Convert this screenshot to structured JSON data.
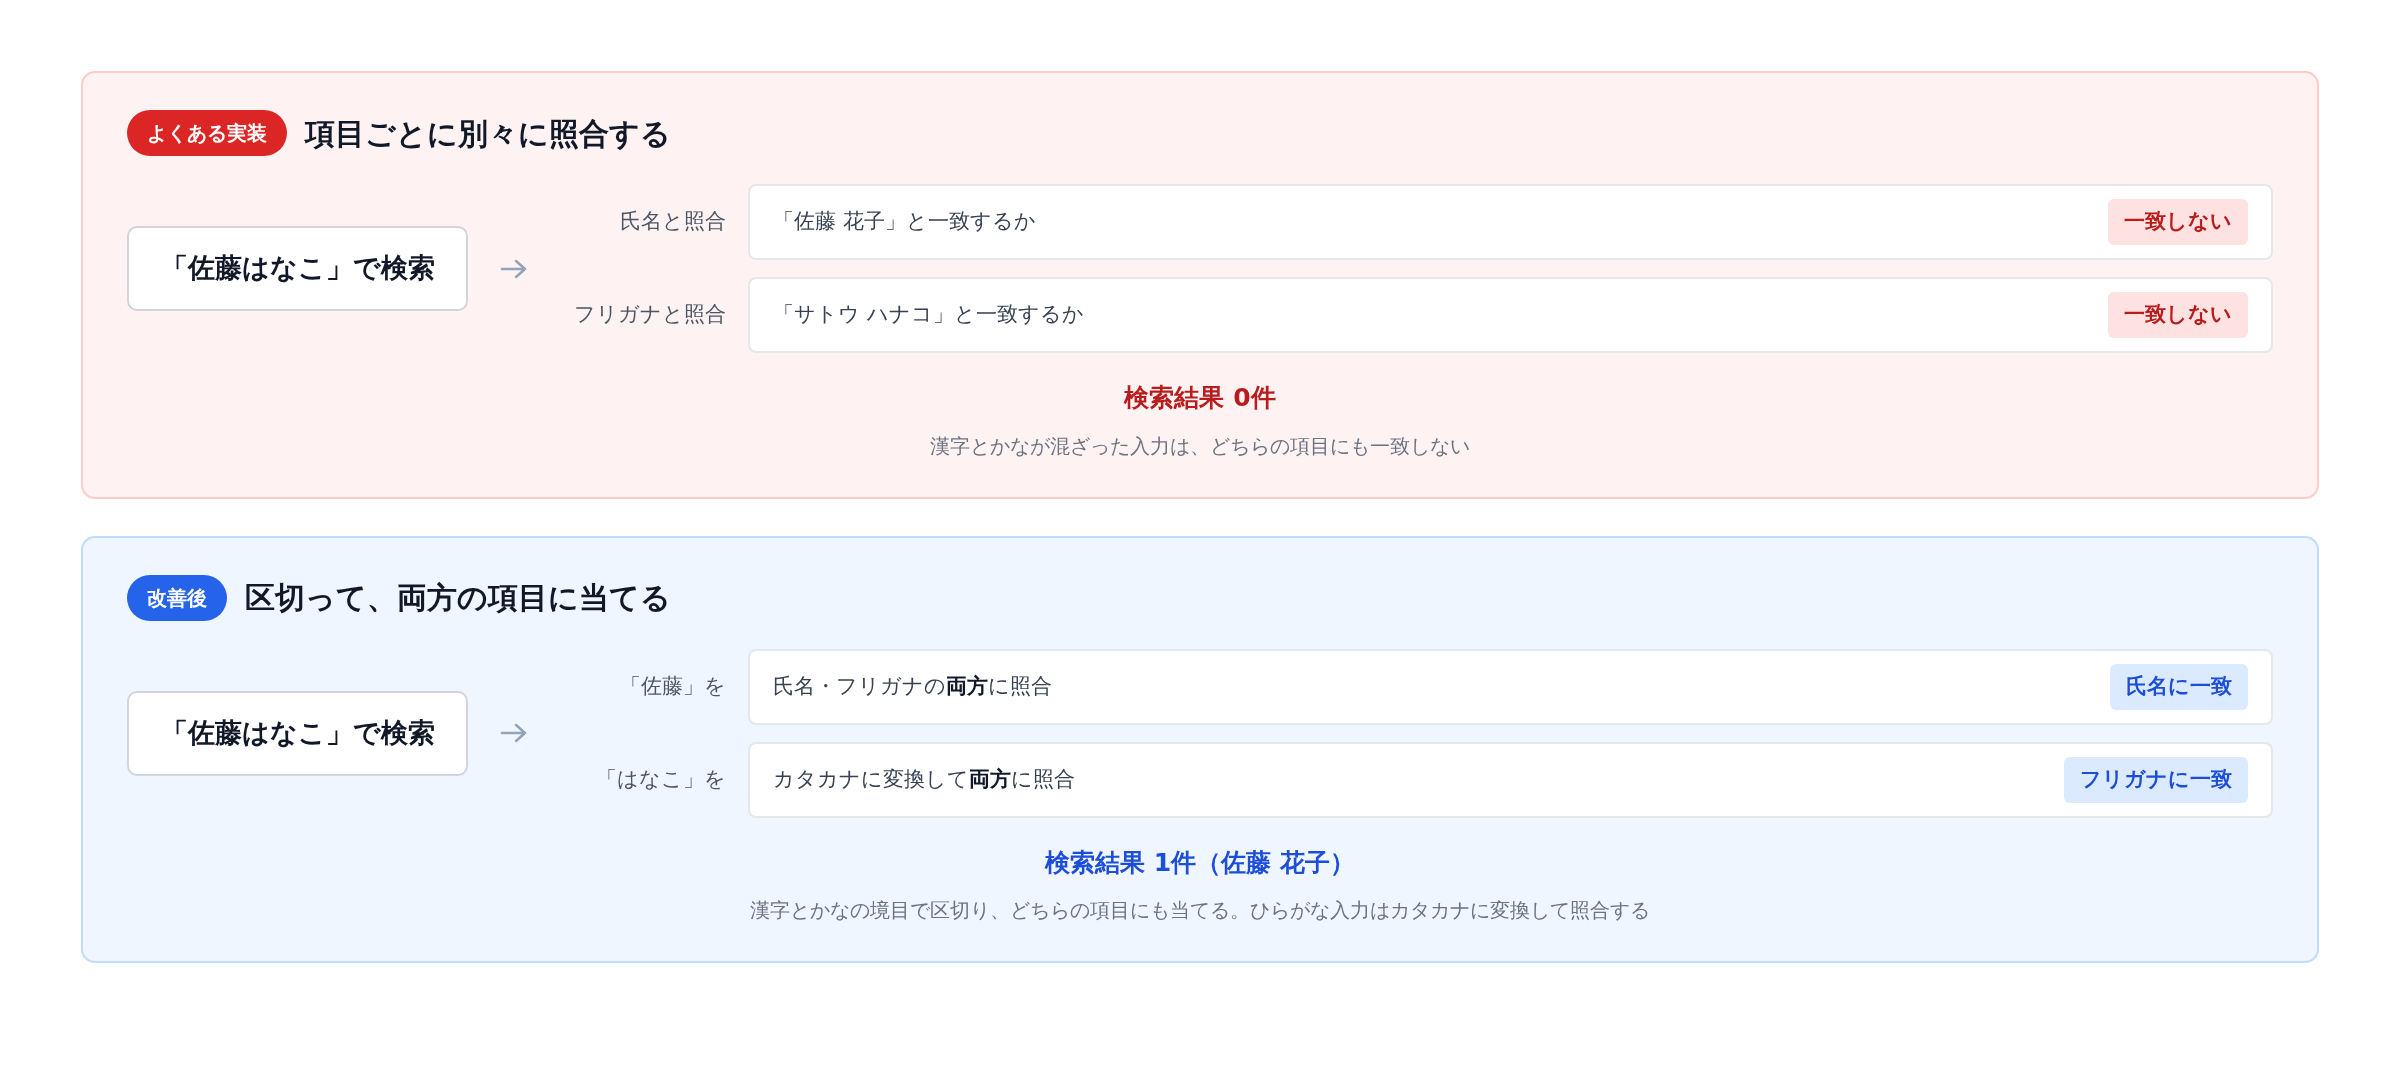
{
  "panels": [
    {
      "kind": "bad",
      "badge": "よくある実装",
      "title": "項目ごとに別々に照合する",
      "query": "「佐藤はなこ」で検索",
      "rows": [
        {
          "label": "氏名と照合",
          "text": "「佐藤 花子」と一致するか",
          "result": "一致しない"
        },
        {
          "label": "フリガナと照合",
          "text": "「サトウ ハナコ」と一致するか",
          "result": "一致しない"
        }
      ],
      "result_title": "検索結果 0件",
      "note": "漢字とかなが混ざった入力は、どちらの項目にも一致しない"
    },
    {
      "kind": "good",
      "badge": "改善後",
      "title": "区切って、両方の項目に当てる",
      "query": "「佐藤はなこ」で検索",
      "rows": [
        {
          "label": "「佐藤」を",
          "text": "氏名・フリガナの**両方**に照合",
          "result": "氏名に一致"
        },
        {
          "label": "「はなこ」を",
          "text": "カタカナに変換して**両方**に照合",
          "result": "フリガナに一致"
        }
      ],
      "result_title": "検索結果 1件（佐藤 花子）",
      "note": "漢字とかなの境目で区切り、どちらの項目にも当てる。ひらがな入力はカタカナに変換して照合する"
    }
  ]
}
